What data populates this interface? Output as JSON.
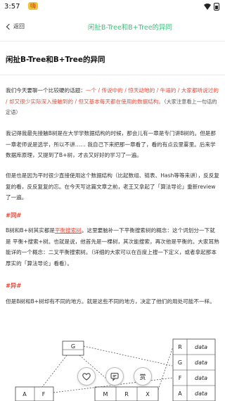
{
  "status": {
    "time": "3:57",
    "notif": "嗨"
  },
  "nav": {
    "back_label": "返回",
    "title": "闲扯B-Tree和B+Tree的异同"
  },
  "article": {
    "title": "闲扯B-Tree和B+Tree的异同",
    "p1": {
      "lead": "我们今天要聊一个比较硬的话题：",
      "highlight": "一个 / 传说中的 / 惊天动地的 / 牛逼的 / 大家都听说过的 / 却又很少实际深入接触到的 / 但又基本每天都在使用的数据结构。",
      "hint": "（大家注意看上一句话的定语）"
    },
    "p2": "我记得我最先接触B树是在大学学数据结构的时候，那会儿有一章是专门讲B树的。但是那一章老师说是选学，所以不讲…… 我自己下来把那一章看了，看的有点云里雾里。后来学数据库原理，又提到了B+树，才去又好好的学习了一遍。",
    "p3": "但是也是因为平时很少直接使用这个数据结构（比起数组、链表、Hash等等来讲），反反复复的看，反反复复的忘。在今天写这篇文章之前，老王又拿起了「算法导论」重新review了一遍。",
    "section_same": "#同#",
    "p4": {
      "lead": "B树和B+树其实都是",
      "highlight": "平衡搜索树",
      "rest": "。这里要脑补一下平衡搜索树的概念：这个词划分一下就是 平衡+搜索+树。也就是说，他首先是一棵树，其次能搜索，再次他是平衡的。大家耳熟能详的一个概念：二叉平衡搜索树。（详细的大家可以在百度上搜一下定义，或者拿起那本厚实的「算法导论」看看）。"
    },
    "section_diff": "#异#",
    "p5": "但是B树和B+树却有不同的地方。就是这些不同的地方，决定了他们的用处可能不一样。"
  },
  "diagram": {
    "root_key": "G",
    "left_keys": [
      "A",
      "F"
    ],
    "mid_keys": [
      "M",
      "R",
      "X"
    ],
    "records": [
      {
        "key": "R",
        "value": "data"
      },
      {
        "key": "G",
        "value": "data"
      },
      {
        "key": "F",
        "value": "data"
      },
      {
        "key": "A",
        "value": "data"
      }
    ]
  },
  "fab": {
    "reward_label": "赏"
  },
  "colors": {
    "accent": "#3ebd7a",
    "highlight": "#e74c3c"
  }
}
